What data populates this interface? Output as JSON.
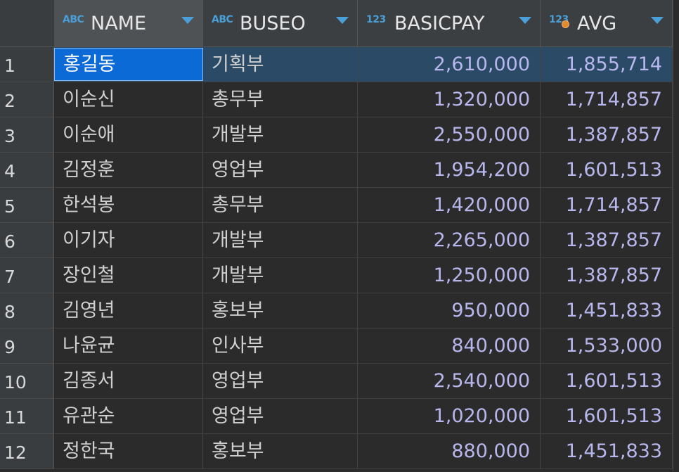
{
  "columns": [
    {
      "type": "ABC",
      "name": "NAME"
    },
    {
      "type": "ABC",
      "name": "BUSEO"
    },
    {
      "type": "123",
      "name": "BASICPAY"
    },
    {
      "type": "123",
      "name": "AVG"
    }
  ],
  "rows": [
    {
      "num": "1",
      "name": "홍길동",
      "buseo": "기획부",
      "basicpay": "2,610,000",
      "avg": "1,855,714"
    },
    {
      "num": "2",
      "name": "이순신",
      "buseo": "총무부",
      "basicpay": "1,320,000",
      "avg": "1,714,857"
    },
    {
      "num": "3",
      "name": "이순애",
      "buseo": "개발부",
      "basicpay": "2,550,000",
      "avg": "1,387,857"
    },
    {
      "num": "4",
      "name": "김정훈",
      "buseo": "영업부",
      "basicpay": "1,954,200",
      "avg": "1,601,513"
    },
    {
      "num": "5",
      "name": "한석봉",
      "buseo": "총무부",
      "basicpay": "1,420,000",
      "avg": "1,714,857"
    },
    {
      "num": "6",
      "name": "이기자",
      "buseo": "개발부",
      "basicpay": "2,265,000",
      "avg": "1,387,857"
    },
    {
      "num": "7",
      "name": "장인철",
      "buseo": "개발부",
      "basicpay": "1,250,000",
      "avg": "1,387,857"
    },
    {
      "num": "8",
      "name": "김영년",
      "buseo": "홍보부",
      "basicpay": "950,000",
      "avg": "1,451,833"
    },
    {
      "num": "9",
      "name": "나윤균",
      "buseo": "인사부",
      "basicpay": "840,000",
      "avg": "1,533,000"
    },
    {
      "num": "10",
      "name": "김종서",
      "buseo": "영업부",
      "basicpay": "2,540,000",
      "avg": "1,601,513"
    },
    {
      "num": "11",
      "name": "유관순",
      "buseo": "영업부",
      "basicpay": "1,020,000",
      "avg": "1,601,513"
    },
    {
      "num": "12",
      "name": "정한국",
      "buseo": "홍보부",
      "basicpay": "880,000",
      "avg": "1,451,833"
    }
  ],
  "colors": {
    "accent": "#4a9fd8",
    "selection": "#0b6ad6",
    "selected_row": "#2a4a66",
    "number_text": "#b7b7ee",
    "modified_dot": "#e08a2c"
  }
}
